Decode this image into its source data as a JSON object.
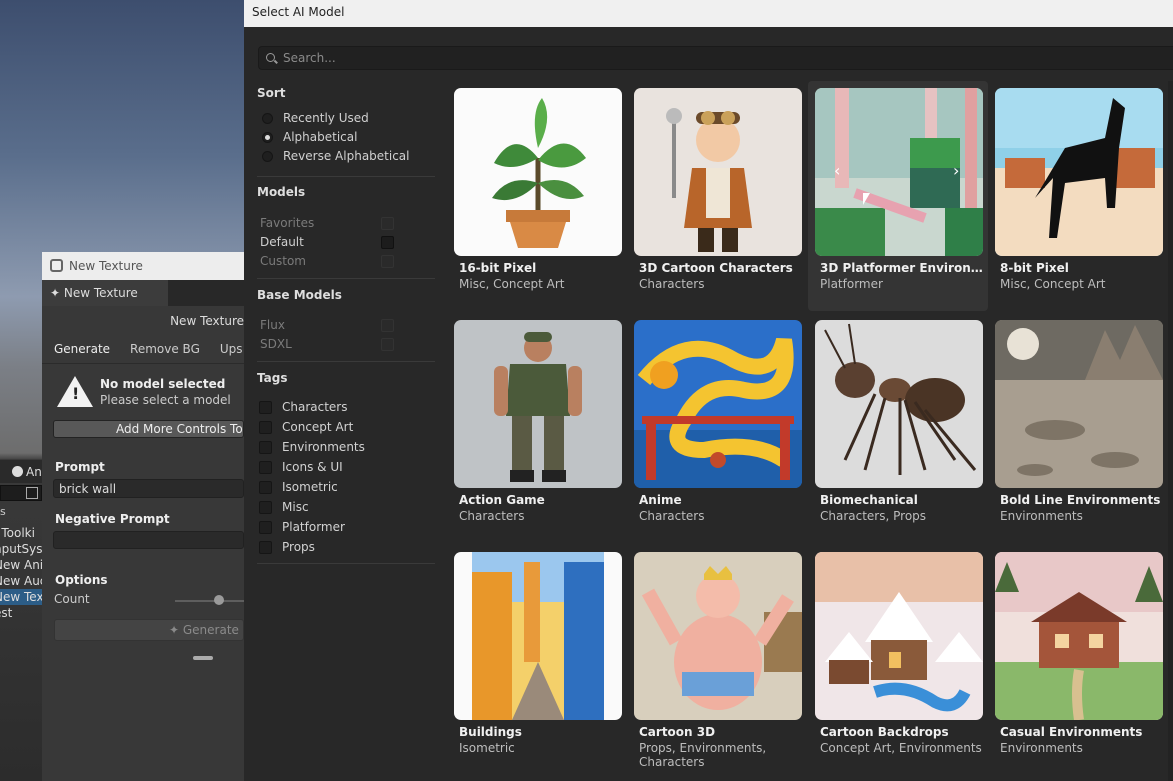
{
  "background": {
    "tab_label": "An",
    "list": [
      {
        "text": "I Toolki",
        "selected": false
      },
      {
        "text": "nputSys",
        "selected": false
      },
      {
        "text": "New Ani",
        "selected": false
      },
      {
        "text": "New Auc",
        "selected": false
      },
      {
        "text": "New Tex",
        "selected": true
      },
      {
        "text": "est",
        "selected": false
      }
    ],
    "e_label": "s"
  },
  "texture_panel": {
    "window_title": "New Texture",
    "tab_label": "New Texture",
    "asset_name": "New Texture",
    "subtabs": [
      "Generate",
      "Remove BG",
      "Ups"
    ],
    "warning_title": "No model selected",
    "warning_text": "Please select a model",
    "add_controls_label": "Add More Controls To P",
    "prompt_label": "Prompt",
    "prompt_value": "brick wall",
    "negative_prompt_label": "Negative Prompt",
    "negative_prompt_value": "",
    "options_label": "Options",
    "count_label": "Count",
    "count_level": 0.55,
    "generate_label": "Generate"
  },
  "model_window": {
    "title": "Select AI Model",
    "search_placeholder": "Search...",
    "sort": {
      "title": "Sort",
      "options": [
        {
          "label": "Recently Used",
          "selected": false
        },
        {
          "label": "Alphabetical",
          "selected": true
        },
        {
          "label": "Reverse Alphabetical",
          "selected": false
        }
      ]
    },
    "models": {
      "title": "Models",
      "items": [
        {
          "label": "Favorites",
          "enabled": false
        },
        {
          "label": "Default",
          "enabled": true
        },
        {
          "label": "Custom",
          "enabled": false
        }
      ]
    },
    "base_models": {
      "title": "Base Models",
      "items": [
        {
          "label": "Flux",
          "enabled": false
        },
        {
          "label": "SDXL",
          "enabled": false
        }
      ]
    },
    "tags": {
      "title": "Tags",
      "items": [
        "Characters",
        "Concept Art",
        "Environments",
        "Icons & UI",
        "Isometric",
        "Misc",
        "Platformer",
        "Props"
      ]
    },
    "cards": [
      {
        "title": "16-bit Pixel",
        "subtitle": "Misc, Concept Art",
        "art": "pixel-plant"
      },
      {
        "title": "3D Cartoon Characters",
        "subtitle": "Characters",
        "art": "steampunk-boy"
      },
      {
        "title": "3D Platformer Environme...",
        "subtitle": "Platformer",
        "art": "platformer-level",
        "hovered": true,
        "prev_arrow": "‹",
        "next_arrow": "›"
      },
      {
        "title": "8-bit Pixel",
        "subtitle": "Misc, Concept Art",
        "art": "pixel-horse"
      },
      {
        "title": "Action Game",
        "subtitle": "Characters",
        "art": "soldier"
      },
      {
        "title": "Anime",
        "subtitle": "Characters",
        "art": "dragon"
      },
      {
        "title": "Biomechanical",
        "subtitle": "Characters, Props",
        "art": "metal-ant"
      },
      {
        "title": "Bold Line Environments",
        "subtitle": "Environments",
        "art": "moon-craters"
      },
      {
        "title": "Buildings",
        "subtitle": "Isometric",
        "art": "colonial-street"
      },
      {
        "title": "Cartoon 3D",
        "subtitle": "Props, Environments, Characters",
        "art": "cartoon-king"
      },
      {
        "title": "Cartoon Backdrops",
        "subtitle": "Concept Art, Environments",
        "art": "snowy-village"
      },
      {
        "title": "Casual Environments",
        "subtitle": "Environments",
        "art": "cabin-meadow"
      }
    ]
  }
}
